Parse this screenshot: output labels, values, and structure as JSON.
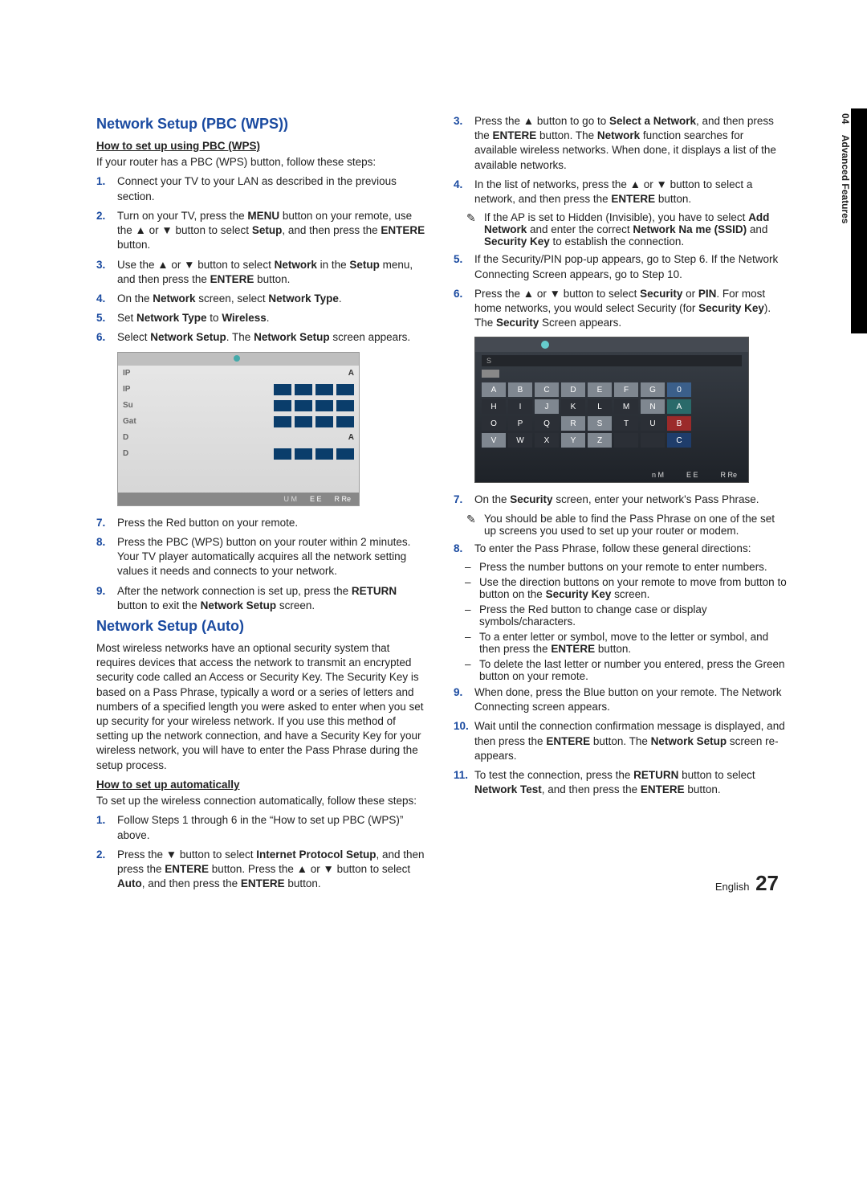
{
  "side_tab": {
    "section": "04",
    "title": "Advanced Features"
  },
  "left": {
    "h_pbc": "Network Setup (PBC (WPS))",
    "sub_pbc": "How to set up using PBC (WPS)",
    "pbc_intro": "If your router has a PBC (WPS) button, follow these steps:",
    "pbc": [
      "Connect your TV to your LAN as described in the previous section.",
      "Turn on your TV, press the <b>MENU</b> button on your remote, use the ▲ or ▼ button to select <b>Setup</b>, and then press the <b>ENTERE</b> button.",
      "Use the ▲ or ▼ button to select <b>Network</b> in the <b>Setup</b> menu, and then press the <b>ENTERE</b> button.",
      "On the <b>Network</b> screen, select <b>Network Type</b>.",
      "Set <b>Network Type</b> to <b>Wireless</b>.",
      "Select <b>Network Setup</b>. The <b>Network Setup</b> screen appears."
    ],
    "mini1": {
      "rows": [
        {
          "label": "IP",
          "kind": "A"
        },
        {
          "label": "IP"
        },
        {
          "label": "Su"
        },
        {
          "label": "Gat"
        },
        {
          "label": "D",
          "kind": "A"
        },
        {
          "label": "D"
        }
      ],
      "bottom": [
        "U  M",
        "E  E",
        "R Re"
      ]
    },
    "pbc_after": [
      "Press the Red button on your remote.",
      "Press the PBC (WPS) button on your router within 2 minutes. Your TV player automatically acquires all the network setting values it needs and connects to your network.",
      "After the network connection is set up, press the <b>RETURN</b> button to exit the <b>Network Setup</b> screen."
    ],
    "h_auto": "Network Setup (Auto)",
    "auto_para": "Most wireless networks have an optional security system that requires devices that access the network to transmit an encrypted security code called an Access or Security Key. The Security Key is based on a Pass Phrase, typically a word or a series of letters and numbers of a specified length you were asked to enter when you set up security for your wireless network. If you use this method of setting up the network connection, and have a Security Key for your wireless network, you will have to enter the Pass Phrase during the setup process.",
    "sub_auto": "How to set up automatically",
    "auto_intro": "To set up the wireless connection automatically, follow these steps:",
    "auto": [
      "Follow Steps 1 through 6 in the “How to set up PBC (WPS)” above.",
      "Press the ▼ button to select <b>Internet Protocol Setup</b>, and then press the <b>ENTERE</b> button. Press the ▲ or ▼ button to select <b>Auto</b>, and then press the <b>ENTERE</b> button."
    ]
  },
  "right": {
    "steps_a": [
      "Press the ▲ button to go to <b>Select a Network</b>, and then press the <b>ENTERE</b> button. The <b>Network</b> function searches for available wireless networks. When done, it displays a list of the available networks.",
      "In the list of networks, press the ▲ or ▼ button to select a network, and then press the <b>ENTERE</b> button."
    ],
    "note_a": "If the AP is set to Hidden (Invisible), you have to select <b>Add Network</b> and enter the correct <b>Network Na me (SSID)</b> and <b>Security Key</b> to establish the connection.",
    "steps_b": [
      "If the Security/PIN pop-up appears, go to Step 6. If the Network Connecting Screen appears, go to Step 10.",
      "Press the ▲ or ▼ button to select <b>Security</b> or <b>PIN</b>. For most home networks, you would select Security (for <b>Security Key</b>). The <b>Security</b> Screen appears."
    ],
    "mini2": {
      "field": "S",
      "rows": [
        [
          "A",
          "B",
          "C",
          "D",
          "E",
          "F",
          "G",
          "0"
        ],
        [
          "H",
          "I",
          "J",
          "K",
          "L",
          "M",
          "N",
          "A"
        ],
        [
          "O",
          "P",
          "Q",
          "R",
          "S",
          "T",
          "U",
          "B"
        ],
        [
          "V",
          "W",
          "X",
          "Y",
          "Z",
          " ",
          " ",
          "C"
        ]
      ],
      "bottom": [
        "n  M",
        "E  E",
        "R Re"
      ]
    },
    "steps_c": [
      "On the <b>Security</b> screen, enter your network's Pass Phrase."
    ],
    "note_c": "You should be able to find the Pass Phrase on one of the set up screens you used to set up your router or modem.",
    "step8_intro": "To enter the Pass Phrase, follow these general directions:",
    "dashes": [
      "Press the number buttons on your remote to enter numbers.",
      "Use the direction buttons on your remote to move from button to button on the <b>Security Key</b> screen.",
      "Press the Red button to change case or display symbols/characters.",
      "To a enter letter or symbol, move to the letter or symbol, and then press the <b>ENTERE</b> button.",
      "To delete the last letter or number you entered, press the Green button on your remote."
    ],
    "steps_d": [
      "When done, press the Blue button on your remote. The Network Connecting screen appears.",
      "Wait until the connection confirmation message is displayed, and then press the <b>ENTERE</b> button. The <b>Network Setup</b> screen re-appears.",
      "To test the connection, press the <b>RETURN</b> button to select <b>Network Test</b>, and then press the <b>ENTERE</b> button."
    ]
  },
  "footer": {
    "lang": "English",
    "page": "27"
  }
}
